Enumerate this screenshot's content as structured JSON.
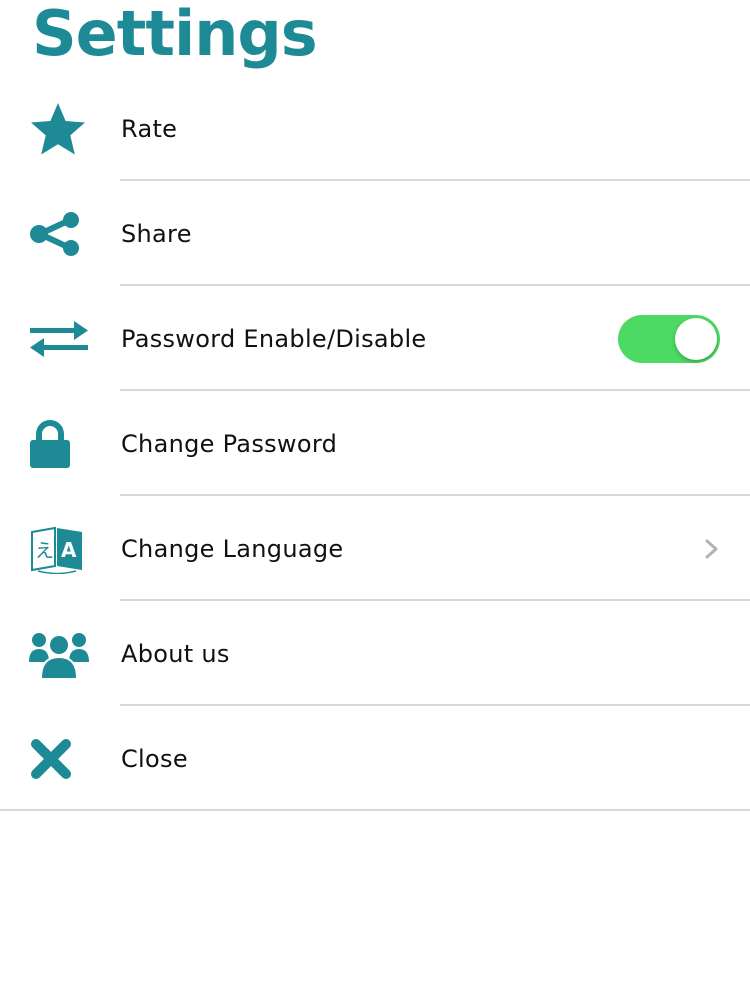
{
  "header": {
    "title": "Settings"
  },
  "colors": {
    "accent": "#1e8a96",
    "toggle_on": "#4cd964",
    "separator": "#d8d8d8",
    "chevron": "#b3b3b3"
  },
  "settings": {
    "items": [
      {
        "label": "Rate",
        "icon": "star-icon"
      },
      {
        "label": "Share",
        "icon": "share-icon"
      },
      {
        "label": "Password Enable/Disable",
        "icon": "swap-arrows-icon",
        "toggle_on": true
      },
      {
        "label": "Change Password",
        "icon": "lock-icon"
      },
      {
        "label": "Change Language",
        "icon": "translate-icon",
        "accessory": "chevron-right-icon"
      },
      {
        "label": "About us",
        "icon": "group-icon"
      },
      {
        "label": "Close",
        "icon": "close-icon"
      }
    ],
    "language_icon_glyphs": [
      "え",
      "A"
    ]
  }
}
